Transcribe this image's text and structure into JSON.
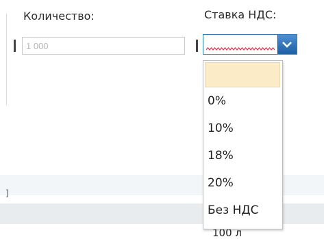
{
  "quantity": {
    "label": "Количество:",
    "value": "1 000"
  },
  "vat": {
    "label": "Ставка НДС:",
    "selected_value": "",
    "options": [
      "",
      "0%",
      "10%",
      "18%",
      "20%",
      "Без НДС"
    ]
  },
  "background": {
    "partial_text": "100 л",
    "band_text": "]"
  },
  "colors": {
    "dropdown_highlight": "#fcebc7",
    "accent": "#2c7bb6",
    "error_wave": "#e0394b"
  },
  "icons": {
    "dropdown_arrow": "chevron-down-icon"
  }
}
